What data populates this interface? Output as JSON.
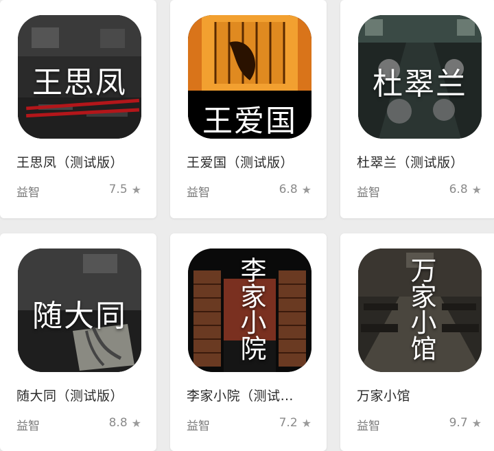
{
  "apps": [
    {
      "title": "王思凤（测试版）",
      "category": "益智",
      "rating": "7.5",
      "icon_text": "王思凤",
      "icon_style": "classroom"
    },
    {
      "title": "王爱国（测试版）",
      "category": "益智",
      "rating": "6.8",
      "icon_text": "王爱国",
      "icon_style": "fire"
    },
    {
      "title": "杜翠兰（测试版）",
      "category": "益智",
      "rating": "6.8",
      "icon_text": "杜翠兰",
      "icon_style": "train"
    },
    {
      "title": "随大同（测试版）",
      "category": "益智",
      "rating": "8.8",
      "icon_text": "随大同",
      "icon_style": "room"
    },
    {
      "title": "李家小院（测试…",
      "category": "益智",
      "rating": "7.2",
      "icon_text": "李家小院",
      "icon_style": "gate"
    },
    {
      "title": "万家小馆",
      "category": "益智",
      "rating": "9.7",
      "icon_text": "万家小馆",
      "icon_style": "diner"
    }
  ],
  "icons": {
    "rating": "star-icon"
  },
  "colors": {
    "background": "#ececec",
    "card": "#ffffff",
    "title": "#2a2a2a",
    "muted": "#7a7a7a"
  }
}
